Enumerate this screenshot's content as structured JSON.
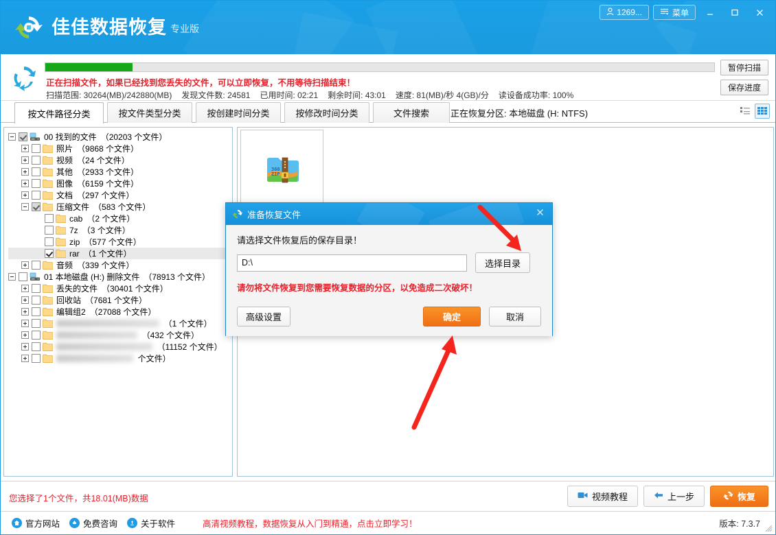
{
  "titlebar": {
    "app_name": "佳佳数据恢复",
    "edition": "专业版",
    "user_pill": "1269...",
    "menu_label": "菜单",
    "minimize_icon": "minimize-icon",
    "maximize_icon": "maximize-icon",
    "close_icon": "close-icon",
    "accent_color": "#1a9ae0"
  },
  "scan": {
    "progress_percent": 13,
    "progress_color": "#16a818",
    "warning": "正在扫描文件，如果已经找到您丢失的文件，可以立即恢复，不用等待扫描结束！",
    "warning_color": "#e8202a",
    "stats": [
      {
        "label": "扫描范围:",
        "value": "30264(MB)/242880(MB)"
      },
      {
        "label": "发现文件数:",
        "value": "24581"
      },
      {
        "label": "已用时间:",
        "value": "02:21"
      },
      {
        "label": "剩余时间:",
        "value": "43:01"
      },
      {
        "label": "速度:",
        "value": "81(MB)/秒  4(GB)/分"
      },
      {
        "label": "读设备成功率:",
        "value": "100%"
      }
    ],
    "pause_button": "暂停扫描",
    "save_button": "保存进度"
  },
  "tabs": {
    "items": [
      {
        "label": "按文件路径分类",
        "active": true
      },
      {
        "label": "按文件类型分类",
        "active": false
      },
      {
        "label": "按创建时间分类",
        "active": false
      },
      {
        "label": "按修改时间分类",
        "active": false
      },
      {
        "label": "文件搜索",
        "active": false
      }
    ],
    "partition_label": "正在恢复分区: 本地磁盘 (H: NTFS)",
    "view_list_icon": "list-view-icon",
    "view_grid_icon": "grid-view-icon"
  },
  "tree": {
    "nodes": [
      {
        "indent": 0,
        "expander": "minus",
        "check": "gray",
        "icon": "drive",
        "name": "00 找到的文件",
        "count": "（20203 个文件）",
        "blur": false
      },
      {
        "indent": 1,
        "expander": "plus",
        "check": "none",
        "icon": "folder",
        "name": "照片",
        "count": "（9868 个文件）",
        "blur": false
      },
      {
        "indent": 1,
        "expander": "plus",
        "check": "none",
        "icon": "folder",
        "name": "视频",
        "count": "（24 个文件）",
        "blur": false
      },
      {
        "indent": 1,
        "expander": "plus",
        "check": "none",
        "icon": "folder",
        "name": "其他",
        "count": "（2933 个文件）",
        "blur": false
      },
      {
        "indent": 1,
        "expander": "plus",
        "check": "none",
        "icon": "folder",
        "name": "图像",
        "count": "（6159 个文件）",
        "blur": false
      },
      {
        "indent": 1,
        "expander": "plus",
        "check": "none",
        "icon": "folder",
        "name": "文档",
        "count": "（297 个文件）",
        "blur": false
      },
      {
        "indent": 1,
        "expander": "minus",
        "check": "gray",
        "icon": "folder",
        "name": "压缩文件",
        "count": "（583 个文件）",
        "blur": false
      },
      {
        "indent": 2,
        "expander": "hidden",
        "check": "none",
        "icon": "folder",
        "name": "cab",
        "count": "（2 个文件）",
        "blur": false
      },
      {
        "indent": 2,
        "expander": "hidden",
        "check": "none",
        "icon": "folder",
        "name": "7z",
        "count": "（3 个文件）",
        "blur": false
      },
      {
        "indent": 2,
        "expander": "hidden",
        "check": "none",
        "icon": "folder",
        "name": "zip",
        "count": "（577 个文件）",
        "blur": false
      },
      {
        "indent": 2,
        "expander": "hidden",
        "check": "checked",
        "icon": "folder",
        "name": "rar",
        "count": "（1 个文件）",
        "blur": false,
        "selected": true
      },
      {
        "indent": 1,
        "expander": "plus",
        "check": "none",
        "icon": "folder",
        "name": "音频",
        "count": "（339 个文件）",
        "blur": false
      },
      {
        "indent": 0,
        "expander": "minus",
        "check": "none",
        "icon": "drive",
        "name": "01 本地磁盘 (H:) 删除文件",
        "count": "（78913 个文件）",
        "blur": false
      },
      {
        "indent": 1,
        "expander": "plus",
        "check": "none",
        "icon": "folder",
        "name": "丢失的文件",
        "count": "（30401 个文件）",
        "blur": false
      },
      {
        "indent": 1,
        "expander": "plus",
        "check": "none",
        "icon": "folder",
        "name": "回收站",
        "count": "（7681 个文件）",
        "blur": false
      },
      {
        "indent": 1,
        "expander": "plus",
        "check": "none",
        "icon": "folder",
        "name": "编辑组2",
        "count": "（27088 个文件）",
        "blur": false
      },
      {
        "indent": 1,
        "expander": "plus",
        "check": "none",
        "icon": "folder",
        "name": "",
        "count": "（1 个文件）",
        "blur": true,
        "blur_width": 150
      },
      {
        "indent": 1,
        "expander": "plus",
        "check": "none",
        "icon": "folder",
        "name": "",
        "count": "（432 个文件）",
        "blur": true,
        "blur_width": 118
      },
      {
        "indent": 1,
        "expander": "plus",
        "check": "none",
        "icon": "folder",
        "name": "",
        "count": "（11152 个文件）",
        "blur": true,
        "blur_width": 140
      },
      {
        "indent": 1,
        "expander": "plus",
        "check": "none",
        "icon": "folder",
        "name": "",
        "count": "个文件）",
        "blur": true,
        "blur_width": 112
      }
    ]
  },
  "files": {
    "items": [
      {
        "icon_name": "360zip-archive-icon",
        "label": ""
      }
    ]
  },
  "dialog": {
    "title": "准备恢复文件",
    "icon": "recover-icon",
    "close_icon": "close-icon",
    "prompt": "请选择文件恢复后的保存目录！",
    "path_value": "D:\\",
    "browse_button": "选择目录",
    "warning": "请勿将文件恢复到您需要恢复数据的分区，以免造成二次破坏！",
    "warning_color": "#e8202a",
    "advanced_button": "高级设置",
    "confirm_button": "确定",
    "confirm_color": "#ef6e14",
    "cancel_button": "取消"
  },
  "footer": {
    "selection_text": "您选择了1个文件，共18.01(MB)数据",
    "video_tutorial_button": "视频教程",
    "prev_button": "上一步",
    "recover_button": "恢复",
    "status_links": [
      {
        "label": "官方网站",
        "icon": "home-icon"
      },
      {
        "label": "免费咨询",
        "icon": "chat-icon"
      },
      {
        "label": "关于软件",
        "icon": "info-icon"
      }
    ],
    "promo": "高清视频教程，数据恢复从入门到精通，点击立即学习！",
    "version": "版本: 7.3.7"
  }
}
